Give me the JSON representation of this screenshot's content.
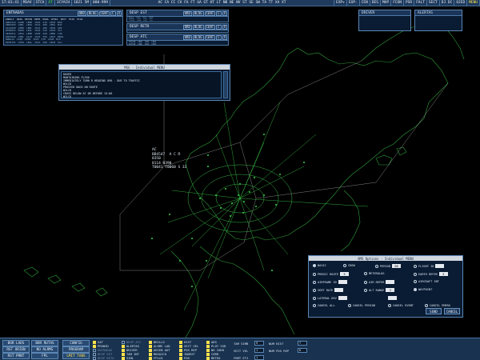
{
  "topbar": {
    "time": "17:01:41",
    "items": [
      "MSAV",
      "STCA",
      "AT",
      "1CYACH",
      "1821 5M",
      "000-999"
    ],
    "codes": "AC CA CC CV FA FT GA GT HT LT NB NE NV ST SE SW TA TT XA XT",
    "right": [
      "EXP+",
      "EXP-",
      "CEN",
      "DES",
      "MAP",
      "FCON",
      "PSR",
      "FALT",
      "SECT",
      "DJ DC",
      "OJED",
      "MENU"
    ]
  },
  "entradas": {
    "title": "ENTRADAS",
    "buttons": [
      "ORD",
      "BLOG",
      "CENT",
      "C",
      "X"
    ],
    "columns": [
      "INDVLT",
      "ORIG",
      "DESTN",
      "ENTR",
      "HORA",
      "LEVEL",
      "SECT",
      "FIJO",
      "FIJO"
    ],
    "rows": [
      [
        "ANE1234",
        "GCRR",
        "LEMD",
        "1510",
        "110",
        "LECB",
        "BCN"
      ],
      [
        "IBE3455",
        "LEBL",
        "LEPA",
        "1512",
        "200",
        "LEPA",
        "MJV"
      ],
      [
        "VLG1020",
        "LEMD",
        "LEBL",
        "1515",
        "180",
        "LECB",
        "GIR"
      ],
      [
        "RYR2831",
        "EGKK",
        "LEAL",
        "1518",
        "310",
        "LECM",
        "VLC"
      ],
      [
        "AEA5011",
        "LEPA",
        "LEMD",
        "1520",
        "240",
        "LEMD",
        "CJN"
      ],
      [
        "AMX7820",
        "LEBL",
        "GCLP",
        "1523",
        "350",
        "LECP",
        "REUS"
      ],
      [
        "SWR412",
        "LSZH",
        "LEPA",
        "1525",
        "370",
        "LECB",
        "MJV"
      ],
      [
        "EZY6721",
        "LFPG",
        "LEAL",
        "1527",
        "320",
        "LECM",
        "VLC"
      ]
    ]
  },
  "desp_est": {
    "title": "DESP EST",
    "buttons": [
      "ORD",
      "BLOG",
      "CENT",
      "C",
      "X"
    ],
    "rows": [
      [
        "AC001",
        "LEPA",
        "1450",
        "TORRE"
      ],
      [
        "BRA002",
        "LEBL",
        "1452",
        "BRO"
      ],
      [
        "CTB103",
        "LEMD",
        "1455",
        "CJN"
      ],
      [
        "UAC004",
        "LEVC",
        "1457",
        "VLC"
      ]
    ]
  },
  "desp_reto": {
    "title": "DESP RETO",
    "buttons": [
      "ORD",
      "BLOG",
      "CENT",
      "C",
      "X"
    ]
  },
  "desp_atc": {
    "title": "DESP ATC",
    "buttons": [
      "ORD",
      "BLOG",
      "CENT",
      "C",
      "X"
    ],
    "rows": [
      [
        "CFG420",
        "LEPA",
        "1501",
        "LECB"
      ],
      [
        "DAT318",
        "LEBL",
        "1503",
        "LECM"
      ]
    ]
  },
  "driver": {
    "title": "DRIVER"
  },
  "alertas": {
    "title": "ALERTAS"
  },
  "message": {
    "title": "MSG - Individual MENU",
    "lines": [
      "ROGER",
      "MANTAINING FL350",
      "IMMEDIATELY TURN R HEADING 090 - DUE TO TRAFFIC",
      "WILCO",
      "PROCEED BACK ON ROUTE",
      "WILCO",
      "CROSS BELOW AT OR BEFORE 15:00",
      "WILCO"
    ]
  },
  "flight_label": {
    "lines": [
      "AC",
      "BB4547  A C R",
      "0350",
      "0114 H390",
      "T0041 T0060 S 32"
    ]
  },
  "options": {
    "title": "AMS Options - Individual MENU",
    "items": [
      {
        "label": "BASIC",
        "on": true
      },
      {
        "label": "CREW",
        "on": false
      },
      {
        "label": "PERIOD",
        "on": false,
        "val": "60"
      },
      {
        "label": "FLIGHT ID",
        "on": false
      },
      {
        "label": "PREDIC ROUTE",
        "on": false,
        "val": "3"
      },
      {
        "label": "METEROLOG",
        "on": false
      },
      {
        "label": "EARTH REFER",
        "on": false,
        "val": "3"
      },
      {
        "label": "AIRFRAME ID",
        "on": false
      },
      {
        "label": "AIR REFER",
        "on": false
      },
      {
        "label": "AIRCRAFT INT",
        "on": false
      },
      {
        "label": "VERT RATE",
        "on": false
      },
      {
        "label": "ALT RANGE",
        "on": false,
        "val": "2"
      },
      {
        "label": "WAYPOINT",
        "on": true
      },
      {
        "label": "LATERAL DEV",
        "on": false
      },
      {
        "label": "CANCEL ALL",
        "on": false
      },
      {
        "label": "CANCEL PERIOD",
        "on": false
      },
      {
        "label": "CANCEL EVENT",
        "on": false
      },
      {
        "label": "CANCEL EMERG",
        "on": false
      }
    ],
    "send": "SEND",
    "cancel": "CANCEL"
  },
  "bottombar": {
    "buttons": [
      "BOR LADS",
      "BOR RUTAS",
      "CONFIG",
      "RST ORIEN",
      "NO ALRMS",
      "PROGRAM",
      "RST PRNT",
      "FPL",
      "LMIT TABS"
    ],
    "checks": [
      {
        "label": "SAT",
        "on": true
      },
      {
        "label": "PREWID",
        "on": true
      },
      {
        "label": "ENTRADAS",
        "on": false,
        "dim": true
      },
      {
        "label": "DESP EST",
        "on": false,
        "dim": true
      },
      {
        "label": "DESP RETO",
        "on": false,
        "dim": true
      },
      {
        "label": "DESP ATC",
        "on": false,
        "dim": true
      },
      {
        "label": "ALERTAS",
        "on": true
      },
      {
        "label": "DRIVER",
        "on": true
      },
      {
        "label": "TAM INT",
        "on": true
      },
      {
        "label": "SIML",
        "on": true
      },
      {
        "label": "BRILLO",
        "on": true
      },
      {
        "label": "ALRMS LAD",
        "on": true
      },
      {
        "label": "ORIEN AUT",
        "on": true
      },
      {
        "label": "MOSAICO",
        "on": true
      },
      {
        "label": "FPLCO",
        "on": true
      },
      {
        "label": "HIST",
        "on": true
      },
      {
        "label": "VECT VEL",
        "on": true
      },
      {
        "label": "POS REP",
        "on": true
      },
      {
        "label": "INDEXT",
        "on": true
      },
      {
        "label": "PSR",
        "on": true
      },
      {
        "label": "ADS",
        "on": true
      },
      {
        "label": "PLOT SSR",
        "on": true
      },
      {
        "label": "NO CORR",
        "on": true
      },
      {
        "label": "CORR",
        "on": true
      },
      {
        "label": "METEO",
        "on": true
      }
    ],
    "tam_simb": "TAM SIMB",
    "tam_simb_val": "9",
    "vect_vel": "VECT VEL",
    "vect_vel_val": "1",
    "frmt_eti": "FRMT ETI",
    "frmt_eti_val": "1",
    "num_hist": "NUM HIST",
    "num_hist_val": "7",
    "num_pos_rep": "NUM POS REP",
    "num_pos_rep_val": "6"
  }
}
